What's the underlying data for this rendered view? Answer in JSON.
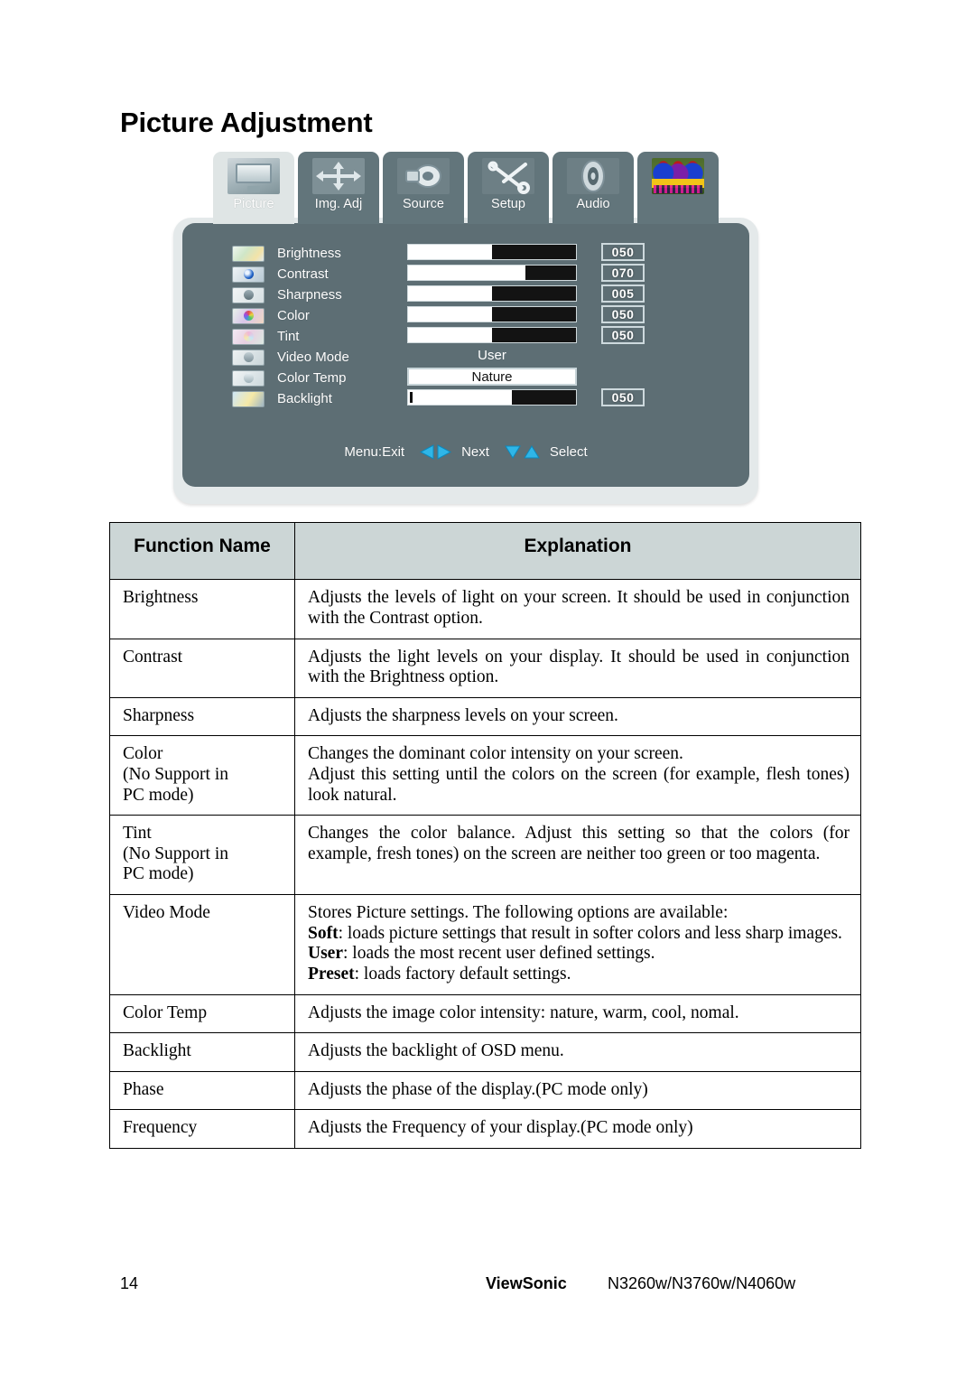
{
  "document": {
    "title": "Picture Adjustment"
  },
  "osd": {
    "tabs": [
      {
        "label": "Picture",
        "icon": "monitor-icon",
        "active": true
      },
      {
        "label": "Img. Adj",
        "icon": "four-arrows-icon",
        "active": false
      },
      {
        "label": "Source",
        "icon": "connector-icon",
        "active": false
      },
      {
        "label": "Setup",
        "icon": "wrench-tools-icon",
        "active": false
      },
      {
        "label": "Audio",
        "icon": "speaker-icon",
        "active": false
      },
      {
        "label": "",
        "icon": "birds-photo-icon",
        "active": false
      }
    ],
    "rows": [
      {
        "label": "Brightness",
        "icon": "brightness-icon",
        "control": "bar",
        "value": "050",
        "fill_pct": 50
      },
      {
        "label": "Contrast",
        "icon": "contrast-icon",
        "control": "bar",
        "value": "070",
        "fill_pct": 30
      },
      {
        "label": "Sharpness",
        "icon": "sharpness-icon",
        "control": "bar",
        "value": "005",
        "fill_pct": 50
      },
      {
        "label": "Color",
        "icon": "color-icon",
        "control": "bar",
        "value": "050",
        "fill_pct": 50
      },
      {
        "label": "Tint",
        "icon": "tint-icon",
        "control": "bar",
        "value": "050",
        "fill_pct": 50
      },
      {
        "label": "Video Mode",
        "icon": "videomode-icon",
        "control": "text",
        "value": "User"
      },
      {
        "label": "Color Temp",
        "icon": "colortemp-icon",
        "control": "box",
        "value": "Nature"
      },
      {
        "label": "Backlight",
        "icon": "backlight-icon",
        "control": "bar",
        "value": "050",
        "fill_pct": 38
      }
    ],
    "hints": {
      "exit": "Menu:Exit",
      "next": "Next",
      "select": "Select"
    },
    "colors": {
      "panel": "#5d6e74",
      "frame": "#e4e9ea",
      "tab_active": "#dfe5e5",
      "tab_inactive": "#62757b",
      "arrow": "#2fb6e8"
    }
  },
  "table": {
    "headers": [
      "Function Name",
      "Explanation"
    ],
    "header_bg": "#ccd6d6",
    "rows": [
      {
        "name": "Brightness",
        "lines": [
          {
            "text": "Adjusts the levels of light on your screen. It should be used in conjunction with the Contrast option.",
            "justify": true
          }
        ]
      },
      {
        "name": "Contrast",
        "lines": [
          {
            "text": "Adjusts the light levels on your display. It should be used in conjunction with the Brightness option.",
            "justify": true
          }
        ]
      },
      {
        "name": "Sharpness",
        "lines": [
          {
            "text": "Adjusts the sharpness levels on your screen.",
            "justify": false
          }
        ]
      },
      {
        "name": "Color\n(No Support in\nPC mode)",
        "lines": [
          {
            "text": "Changes the dominant color intensity on your screen.",
            "justify": false
          },
          {
            "text": "Adjust this setting until the colors on the screen (for example, flesh tones) look natural.",
            "justify": true
          }
        ]
      },
      {
        "name": "Tint\n(No Support in\nPC mode)",
        "lines": [
          {
            "text": "Changes the color balance. Adjust this setting so that the colors (for example, fresh tones) on the screen are neither too green or too magenta.",
            "justify": true
          }
        ]
      },
      {
        "name": "Video Mode",
        "lines": [
          {
            "text": "Stores Picture settings. The following options are available:",
            "justify": false
          },
          {
            "bold": "Soft",
            "text": ": loads picture settings that result in softer colors and less sharp images.",
            "justify": true
          },
          {
            "bold": "User",
            "text": ": loads the most recent user defined settings.",
            "justify": false
          },
          {
            "bold": "Preset",
            "text": ": loads factory default settings.",
            "justify": false
          }
        ]
      },
      {
        "name": "Color Temp",
        "lines": [
          {
            "text": "Adjusts the image color intensity: nature, warm, cool, nomal.",
            "justify": true
          }
        ]
      },
      {
        "name": "Backlight",
        "lines": [
          {
            "text": "Adjusts the backlight of OSD menu.",
            "justify": false
          }
        ]
      },
      {
        "name": "Phase",
        "lines": [
          {
            "text": "Adjusts the phase of the display.(PC mode only)",
            "justify": false
          }
        ]
      },
      {
        "name": "Frequency",
        "lines": [
          {
            "text": "Adjusts the Frequency of your display.(PC mode only)",
            "justify": false
          }
        ]
      }
    ]
  },
  "footer": {
    "page_number": "14",
    "brand": "ViewSonic",
    "models": "N3260w/N3760w/N4060w"
  }
}
